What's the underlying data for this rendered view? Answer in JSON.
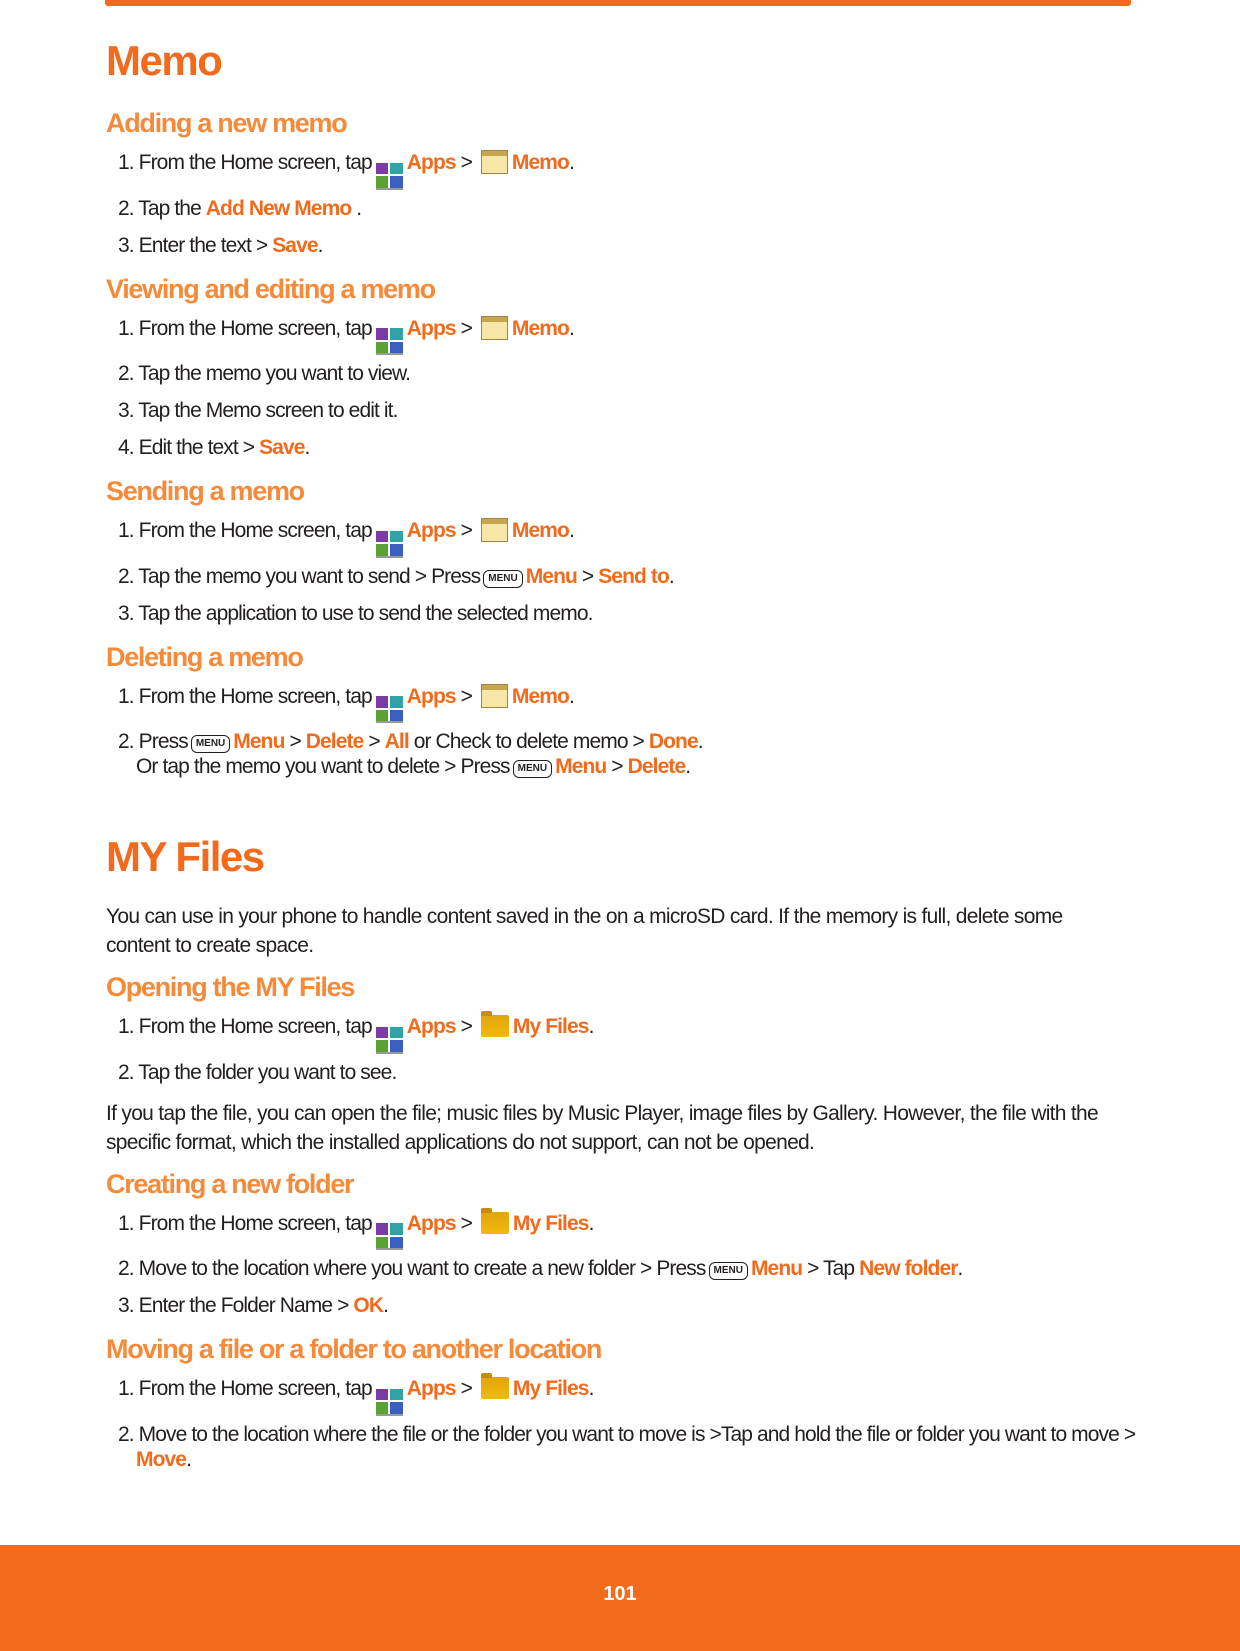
{
  "colors": {
    "accent": "#f26b1d"
  },
  "sections": [
    {
      "type": "h1",
      "text": "Memo"
    },
    {
      "type": "h2",
      "text": "Adding a new memo"
    },
    {
      "type": "step",
      "segs": [
        {
          "t": "1. From the Home screen, tap"
        },
        {
          "icon": "apps-icon"
        },
        {
          "t": "Apps",
          "hl": true
        },
        {
          "t": " > "
        },
        {
          "icon": "memo-icon"
        },
        {
          "t": "Memo",
          "hl": true
        },
        {
          "t": "."
        }
      ]
    },
    {
      "type": "step",
      "segs": [
        {
          "t": "2. Tap the "
        },
        {
          "t": "Add New Memo",
          "hl": true
        },
        {
          "t": " ."
        }
      ]
    },
    {
      "type": "step",
      "segs": [
        {
          "t": "3. Enter the text > "
        },
        {
          "t": "Save",
          "hl": true
        },
        {
          "t": "."
        }
      ]
    },
    {
      "type": "h2",
      "text": "Viewing and editing a memo"
    },
    {
      "type": "step",
      "segs": [
        {
          "t": "1. From the Home screen, tap"
        },
        {
          "icon": "apps-icon"
        },
        {
          "t": "Apps",
          "hl": true
        },
        {
          "t": " > "
        },
        {
          "icon": "memo-icon"
        },
        {
          "t": "Memo",
          "hl": true
        },
        {
          "t": "."
        }
      ]
    },
    {
      "type": "step",
      "segs": [
        {
          "t": "2. Tap the memo you want to view."
        }
      ]
    },
    {
      "type": "step",
      "segs": [
        {
          "t": "3. Tap the Memo screen to edit it."
        }
      ]
    },
    {
      "type": "step",
      "segs": [
        {
          "t": "4. Edit the text > "
        },
        {
          "t": "Save",
          "hl": true
        },
        {
          "t": "."
        }
      ]
    },
    {
      "type": "h2",
      "text": "Sending a memo"
    },
    {
      "type": "step",
      "segs": [
        {
          "t": "1. From the Home screen, tap"
        },
        {
          "icon": "apps-icon"
        },
        {
          "t": "Apps",
          "hl": true
        },
        {
          "t": " > "
        },
        {
          "icon": "memo-icon"
        },
        {
          "t": "Memo",
          "hl": true
        },
        {
          "t": "."
        }
      ]
    },
    {
      "type": "step",
      "segs": [
        {
          "t": "2. Tap the memo you want to send > Press"
        },
        {
          "key": "MENU"
        },
        {
          "t": "Menu",
          "hl": true
        },
        {
          "t": " > "
        },
        {
          "t": "Send to",
          "hl": true
        },
        {
          "t": "."
        }
      ]
    },
    {
      "type": "step",
      "segs": [
        {
          "t": "3. Tap the application to use to send the selected memo."
        }
      ]
    },
    {
      "type": "h2",
      "text": "Deleting a memo"
    },
    {
      "type": "step",
      "segs": [
        {
          "t": "1. From the Home screen, tap"
        },
        {
          "icon": "apps-icon"
        },
        {
          "t": "Apps",
          "hl": true
        },
        {
          "t": " > "
        },
        {
          "icon": "memo-icon"
        },
        {
          "t": "Memo",
          "hl": true
        },
        {
          "t": "."
        }
      ]
    },
    {
      "type": "step",
      "segs": [
        {
          "t": "2. Press"
        },
        {
          "key": "MENU"
        },
        {
          "t": "Menu",
          "hl": true
        },
        {
          "t": " > "
        },
        {
          "t": "Delete",
          "hl": true
        },
        {
          "t": " > "
        },
        {
          "t": "All",
          "hl": true
        },
        {
          "t": " or Check to delete memo > "
        },
        {
          "t": "Done",
          "hl": true
        },
        {
          "t": "."
        }
      ],
      "cont": [
        {
          "t": "Or tap the memo you want to delete > Press"
        },
        {
          "key": "MENU"
        },
        {
          "t": "Menu",
          "hl": true
        },
        {
          "t": " > "
        },
        {
          "t": "Delete",
          "hl": true
        },
        {
          "t": "."
        }
      ]
    },
    {
      "type": "h1big",
      "text": "MY Files"
    },
    {
      "type": "para",
      "text": "You can use in your phone to handle content saved in the on a microSD card. If the memory is full, delete some content to create space."
    },
    {
      "type": "h2",
      "text": "Opening the MY Files"
    },
    {
      "type": "step",
      "segs": [
        {
          "t": "1. From the Home screen, tap"
        },
        {
          "icon": "apps-icon"
        },
        {
          "t": "Apps",
          "hl": true
        },
        {
          "t": " > "
        },
        {
          "icon": "folder-icon"
        },
        {
          "t": "My Files",
          "hl": true
        },
        {
          "t": "."
        }
      ]
    },
    {
      "type": "step",
      "segs": [
        {
          "t": "2. Tap the folder you want to see."
        }
      ]
    },
    {
      "type": "para",
      "text": "If you tap the file, you can open the file; music files by Music Player, image files by Gallery. However, the file with the specific format, which the installed applications do not support, can not be opened."
    },
    {
      "type": "h2",
      "text": "Creating a new folder"
    },
    {
      "type": "step",
      "segs": [
        {
          "t": "1. From the Home screen, tap"
        },
        {
          "icon": "apps-icon"
        },
        {
          "t": "Apps",
          "hl": true
        },
        {
          "t": " > "
        },
        {
          "icon": "folder-icon"
        },
        {
          "t": "My Files",
          "hl": true
        },
        {
          "t": "."
        }
      ]
    },
    {
      "type": "step",
      "segs": [
        {
          "t": "2. Move to the location where you want to create a new folder  > Press"
        },
        {
          "key": "MENU"
        },
        {
          "t": "Menu",
          "hl": true
        },
        {
          "t": " > Tap "
        },
        {
          "t": "New folder",
          "hl": true
        },
        {
          "t": "."
        }
      ]
    },
    {
      "type": "step",
      "segs": [
        {
          "t": "3. Enter the Folder Name > "
        },
        {
          "t": "OK",
          "hl": true
        },
        {
          "t": "."
        }
      ]
    },
    {
      "type": "h2",
      "text": "Moving a file or a folder to another location"
    },
    {
      "type": "step",
      "segs": [
        {
          "t": "1. From the Home screen, tap"
        },
        {
          "icon": "apps-icon"
        },
        {
          "t": "Apps",
          "hl": true
        },
        {
          "t": " > "
        },
        {
          "icon": "folder-icon"
        },
        {
          "t": "My Files",
          "hl": true
        },
        {
          "t": "."
        }
      ]
    },
    {
      "type": "step",
      "segs": [
        {
          "t": "2. Move to the location where the file or the folder you want to move is >Tap and hold the file or folder you want to move >"
        }
      ],
      "cont": [
        {
          "t": "Move",
          "hl": true
        },
        {
          "t": "."
        }
      ]
    }
  ],
  "footer": {
    "page_number": "101"
  }
}
